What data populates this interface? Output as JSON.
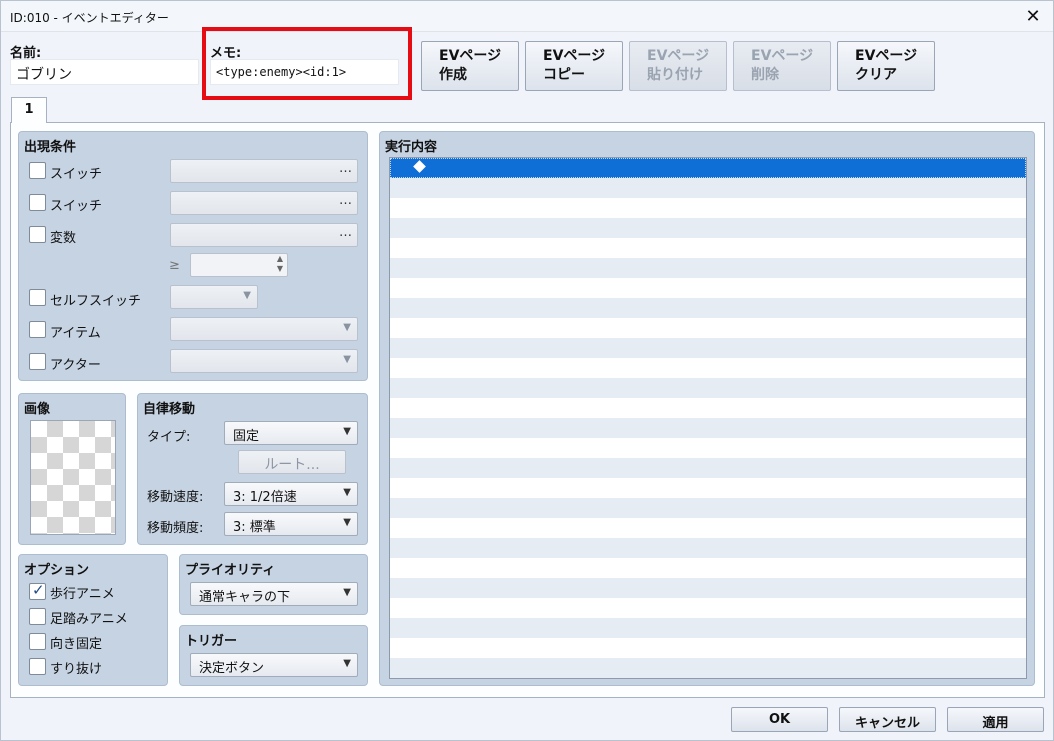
{
  "window": {
    "title": "ID:010 - イベントエディター",
    "close_glyph": "✕"
  },
  "header": {
    "name_label": "名前:",
    "name_value": "ゴブリン",
    "memo_label": "メモ:",
    "memo_value": "<type:enemy><id:1>",
    "highlight_color": "#e50d13"
  },
  "page_buttons": [
    {
      "line1": "EVページ",
      "line2": "作成",
      "enabled": true
    },
    {
      "line1": "EVページ",
      "line2": "コピー",
      "enabled": true
    },
    {
      "line1": "EVページ",
      "line2": "貼り付け",
      "enabled": false
    },
    {
      "line1": "EVページ",
      "line2": "削除",
      "enabled": false
    },
    {
      "line1": "EVページ",
      "line2": "クリア",
      "enabled": true
    }
  ],
  "tabs": [
    {
      "label": "1"
    }
  ],
  "conditions": {
    "title": "出現条件",
    "switch1_label": "スイッチ",
    "switch2_label": "スイッチ",
    "variable_label": "変数",
    "gte_symbol": "≥",
    "self_switch_label": "セルフスイッチ",
    "item_label": "アイテム",
    "actor_label": "アクター",
    "dots": "…"
  },
  "image": {
    "title": "画像"
  },
  "autonomous": {
    "title": "自律移動",
    "type_label": "タイプ:",
    "type_value": "固定",
    "route_label": "ルート...",
    "speed_label": "移動速度:",
    "speed_value": "3: 1/2倍速",
    "freq_label": "移動頻度:",
    "freq_value": "3: 標準"
  },
  "options": {
    "title": "オプション",
    "items": [
      {
        "label": "歩行アニメ",
        "checked": true
      },
      {
        "label": "足踏みアニメ",
        "checked": false
      },
      {
        "label": "向き固定",
        "checked": false
      },
      {
        "label": "すり抜け",
        "checked": false
      }
    ]
  },
  "priority": {
    "title": "プライオリティ",
    "value": "通常キャラの下"
  },
  "trigger": {
    "title": "トリガー",
    "value": "決定ボタン"
  },
  "contents": {
    "title": "実行内容",
    "row_count": 26,
    "selected_index": 0
  },
  "footer": {
    "ok": "OK",
    "cancel": "キャンセル",
    "apply": "適用"
  }
}
